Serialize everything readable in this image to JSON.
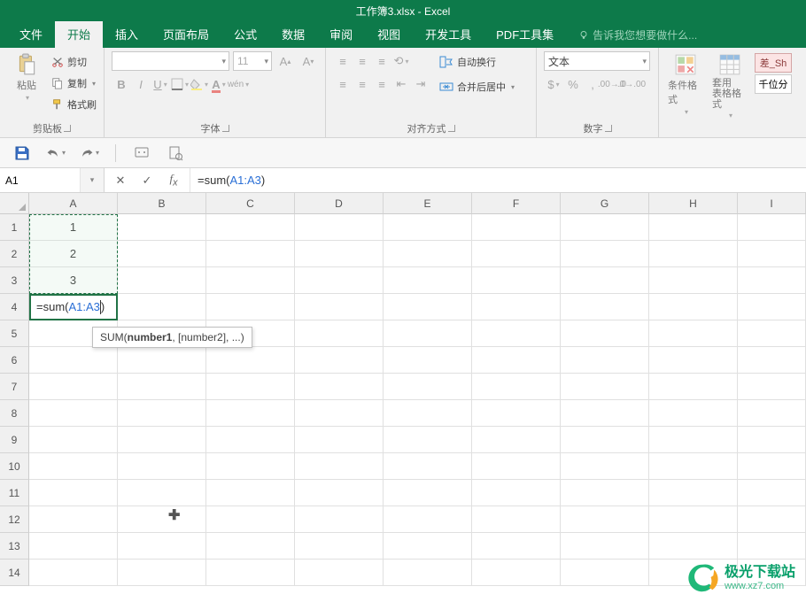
{
  "titlebar": {
    "title": "工作簿3.xlsx - Excel"
  },
  "tabs": {
    "items": [
      "文件",
      "开始",
      "插入",
      "页面布局",
      "公式",
      "数据",
      "审阅",
      "视图",
      "开发工具",
      "PDF工具集"
    ],
    "active_index": 1,
    "tell_me": "告诉我您想要做什么..."
  },
  "ribbon": {
    "clipboard": {
      "paste": "粘贴",
      "cut": "剪切",
      "copy": "复制",
      "format_painter": "格式刷",
      "label": "剪贴板"
    },
    "font": {
      "name_placeholder": "",
      "size_placeholder": "11",
      "label": "字体",
      "wen": "wén"
    },
    "alignment": {
      "wrap": "自动换行",
      "merge": "合并后居中",
      "label": "对齐方式"
    },
    "number": {
      "format_value": "文本",
      "label": "数字"
    },
    "styles": {
      "cond": "条件格式",
      "table": "套用\n表格格式",
      "diff": "差_Sh",
      "thousand": "千位分"
    }
  },
  "qat": {
    "icons": [
      "save-icon",
      "undo-icon",
      "redo-icon",
      "touch-icon",
      "print-preview-icon"
    ]
  },
  "namebox": {
    "value": "A1"
  },
  "formula": {
    "prefix": "=sum(",
    "ref": "A1:A3",
    "suffix": ")"
  },
  "grid": {
    "columns": [
      "A",
      "B",
      "C",
      "D",
      "E",
      "F",
      "G",
      "H",
      "I"
    ],
    "row_count": 14,
    "data": {
      "A1": "1",
      "A2": "2",
      "A3": "3"
    },
    "editing_cell": "A4",
    "editing_prefix": "=sum(",
    "editing_ref": "A1:A3",
    "editing_suffix": ")"
  },
  "tooltip": {
    "func": "SUM(",
    "bold": "number1",
    "rest": ", [number2], ...)"
  },
  "watermark": {
    "name": "极光下载站",
    "url": "www.xz7.com"
  }
}
